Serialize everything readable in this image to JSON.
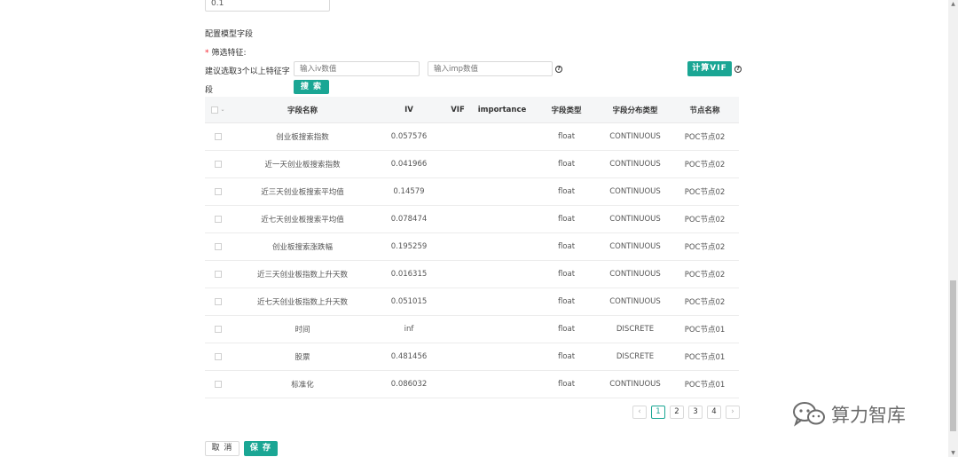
{
  "top_input_value": "0.1",
  "section_title": "配置模型字段",
  "filter": {
    "required_mark": "*",
    "label": "筛选特征:",
    "hint_line1": "建议选取3个以上特征字",
    "hint_line2": "段",
    "iv_placeholder": "输入iv数值",
    "imp_placeholder": "输入imp数值",
    "search_label": "搜 索",
    "calc_vif_label": "计算VIF",
    "help_glyph": "?"
  },
  "table": {
    "headers": {
      "name": "字段名称",
      "iv": "IV",
      "vif": "VIF",
      "importance": "importance",
      "type": "字段类型",
      "dist": "字段分布类型",
      "node": "节点名称"
    },
    "select_chevron": "⌄",
    "rows": [
      {
        "name": "创业板搜索指数",
        "iv": "0.057576",
        "vif": "",
        "importance": "",
        "type": "float",
        "dist": "CONTINUOUS",
        "node": "POC节点02"
      },
      {
        "name": "近一天创业板搜索指数",
        "iv": "0.041966",
        "vif": "",
        "importance": "",
        "type": "float",
        "dist": "CONTINUOUS",
        "node": "POC节点02"
      },
      {
        "name": "近三天创业板搜索平均值",
        "iv": "0.14579",
        "vif": "",
        "importance": "",
        "type": "float",
        "dist": "CONTINUOUS",
        "node": "POC节点02"
      },
      {
        "name": "近七天创业板搜索平均值",
        "iv": "0.078474",
        "vif": "",
        "importance": "",
        "type": "float",
        "dist": "CONTINUOUS",
        "node": "POC节点02"
      },
      {
        "name": "创业板搜索涨跌幅",
        "iv": "0.195259",
        "vif": "",
        "importance": "",
        "type": "float",
        "dist": "CONTINUOUS",
        "node": "POC节点02"
      },
      {
        "name": "近三天创业板指数上升天数",
        "iv": "0.016315",
        "vif": "",
        "importance": "",
        "type": "float",
        "dist": "CONTINUOUS",
        "node": "POC节点02"
      },
      {
        "name": "近七天创业板指数上升天数",
        "iv": "0.051015",
        "vif": "",
        "importance": "",
        "type": "float",
        "dist": "CONTINUOUS",
        "node": "POC节点02"
      },
      {
        "name": "时间",
        "iv": "inf",
        "vif": "",
        "importance": "",
        "type": "float",
        "dist": "DISCRETE",
        "node": "POC节点01"
      },
      {
        "name": "股票",
        "iv": "0.481456",
        "vif": "",
        "importance": "",
        "type": "float",
        "dist": "DISCRETE",
        "node": "POC节点01"
      },
      {
        "name": "标准化",
        "iv": "0.086032",
        "vif": "",
        "importance": "",
        "type": "float",
        "dist": "CONTINUOUS",
        "node": "POC节点01"
      }
    ]
  },
  "pagination": {
    "prev": "‹",
    "pages": [
      "1",
      "2",
      "3",
      "4"
    ],
    "current": "1",
    "next": "›"
  },
  "footer": {
    "cancel_label": "取 消",
    "save_label": "保 存"
  },
  "watermark": {
    "text": "算力智库"
  },
  "colors": {
    "primary": "#1aa694",
    "required": "#f5222d",
    "header_bg": "#f5f6f7"
  }
}
